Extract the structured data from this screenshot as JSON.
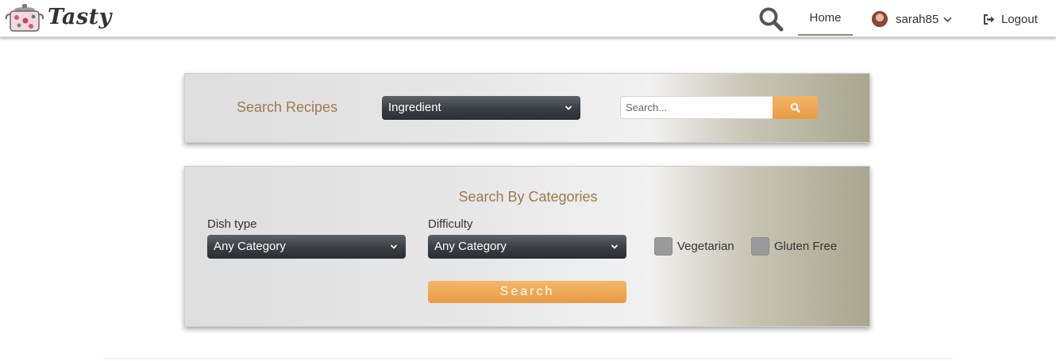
{
  "colors": {
    "accent_gold": "#9c7a4c",
    "orange_button": "#e99a45",
    "dark_select": "#3b4045"
  },
  "navbar": {
    "brand": "Tasty",
    "logo_icon": "cooking-pot-icon",
    "search_icon": "search-icon",
    "home_label": "Home",
    "username": "sarah85",
    "user_menu_icon": "chevron-down-icon",
    "logout_icon": "logout-icon",
    "logout_label": "Logout"
  },
  "search_recipes": {
    "title": "Search Recipes",
    "type_select": "Ingredient",
    "placeholder": "Search...",
    "button_icon": "search-icon"
  },
  "categories": {
    "title": "Search By Categories",
    "dish_type_label": "Dish type",
    "dish_type_value": "Any Category",
    "difficulty_label": "Difficulty",
    "difficulty_value": "Any Category",
    "vegetarian_label": "Vegetarian",
    "vegetarian_checked": false,
    "gluten_free_label": "Gluten Free",
    "gluten_free_checked": false,
    "search_button": "Search"
  }
}
